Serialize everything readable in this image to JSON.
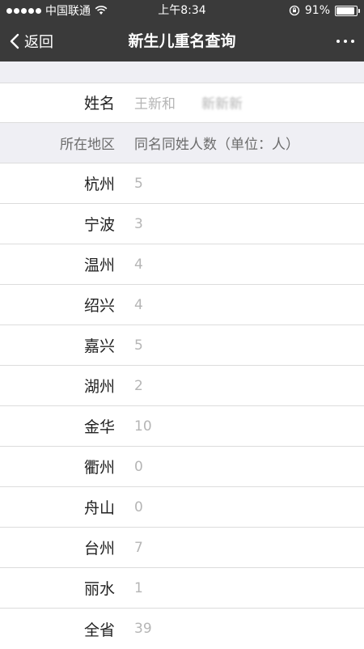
{
  "status": {
    "carrier": "中国联通",
    "time": "上午8:34",
    "battery": "91%",
    "battery_level": 0.91
  },
  "nav": {
    "back": "返回",
    "title": "新生儿重名查询"
  },
  "name_row": {
    "label": "姓名",
    "value1": "王新和",
    "value2": "新新新"
  },
  "header": {
    "region": "所在地区",
    "count": "同名同姓人数（单位：人）"
  },
  "rows": [
    {
      "region": "杭州",
      "count": "5"
    },
    {
      "region": "宁波",
      "count": "3"
    },
    {
      "region": "温州",
      "count": "4"
    },
    {
      "region": "绍兴",
      "count": "4"
    },
    {
      "region": "嘉兴",
      "count": "5"
    },
    {
      "region": "湖州",
      "count": "2"
    },
    {
      "region": "金华",
      "count": "10"
    },
    {
      "region": "衢州",
      "count": "0"
    },
    {
      "region": "舟山",
      "count": "0"
    },
    {
      "region": "台州",
      "count": "7"
    },
    {
      "region": "丽水",
      "count": "1"
    },
    {
      "region": "全省",
      "count": "39"
    }
  ]
}
